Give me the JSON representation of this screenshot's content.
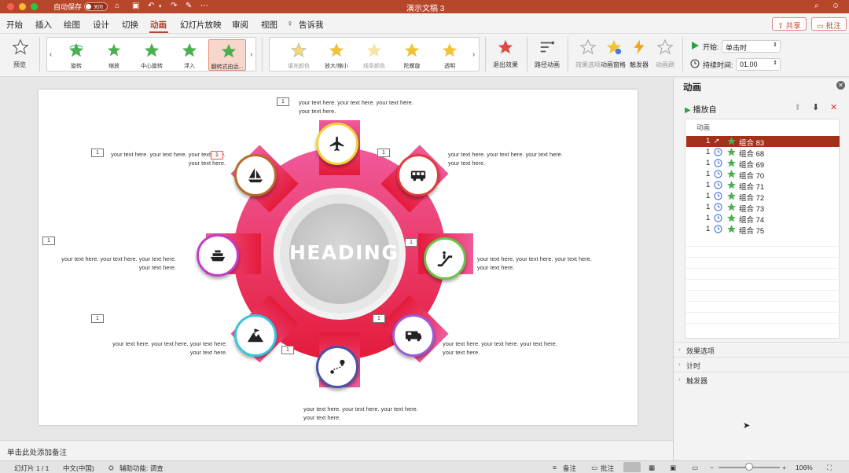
{
  "titlebar": {
    "autosave_label": "自动保存",
    "autosave_state": "关闭",
    "doc_title": "演示文稿 3"
  },
  "tabs": [
    {
      "label": "开始"
    },
    {
      "label": "插入"
    },
    {
      "label": "绘图"
    },
    {
      "label": "设计"
    },
    {
      "label": "切换"
    },
    {
      "label": "动画",
      "active": true
    },
    {
      "label": "幻灯片放映"
    },
    {
      "label": "审阅"
    },
    {
      "label": "视图"
    }
  ],
  "tellme": "告诉我",
  "share_label": "共享",
  "comments_label": "批注",
  "ribbon": {
    "preview": "预览",
    "effects": [
      "旋转",
      "缩放",
      "中心旋转",
      "浮入",
      "翻转式由远..."
    ],
    "emphasis": [
      "填充颜色",
      "放大/缩小",
      "线条颜色",
      "陀螺旋",
      "透明"
    ],
    "exit": "退出效果",
    "path": "路径动画",
    "effect_options": "效果选项",
    "anim_pane": "动画窗格",
    "trigger": "触发器",
    "anim_brush": "动画刷",
    "start_label": "开始:",
    "start_value": "单击时",
    "duration_label": "持续时间:",
    "duration_value": "01.00"
  },
  "slide": {
    "heading": "HEADING",
    "texts": {
      "t1": "your text here. your text here. your text here. your text here.",
      "t2": "your text here. your text here. your text here. your text here.",
      "t3": "your text here. your text here. your text here. your text here.",
      "t4": "your text here. your text here. your text here. your text here.",
      "t5": "your text here. your text here. your text here. your text here.",
      "t6": "your text here. your text here. your text here. your text here.",
      "t7": "your text here. your text here. your text here. your text here.",
      "t8": "your text here. your text here. your text here. your text here."
    },
    "badge": "1",
    "colors": {
      "gear_top": "#f05a9a",
      "gear_bottom": "#e41b3b",
      "airplane": "#f3d23b",
      "bus": "#e33b3b",
      "escalator": "#6cc24a",
      "camper": "#9c5bd6",
      "route": "#4a52a8",
      "mountain": "#37c6d8",
      "ship": "#c63bc8",
      "sailboat": "#b86a2a"
    }
  },
  "notes_placeholder": "单击此处添加备注",
  "status": {
    "slide": "幻灯片 1 / 1",
    "lang": "中文(中国)",
    "access": "辅助功能: 调查",
    "notes": "备注",
    "comments": "批注",
    "zoom": "106%"
  },
  "pane": {
    "title": "动画",
    "play_label": "播放自",
    "list_header": "动画",
    "items": [
      {
        "num": "1",
        "name": "组合 83"
      },
      {
        "num": "1",
        "name": "组合 68"
      },
      {
        "num": "1",
        "name": "组合 69"
      },
      {
        "num": "1",
        "name": "组合 70"
      },
      {
        "num": "1",
        "name": "组合 71"
      },
      {
        "num": "1",
        "name": "组合 72"
      },
      {
        "num": "1",
        "name": "组合 73"
      },
      {
        "num": "1",
        "name": "组合 74"
      },
      {
        "num": "1",
        "name": "组合 75"
      }
    ],
    "sections": [
      "效果选项",
      "计时",
      "触发器"
    ]
  }
}
